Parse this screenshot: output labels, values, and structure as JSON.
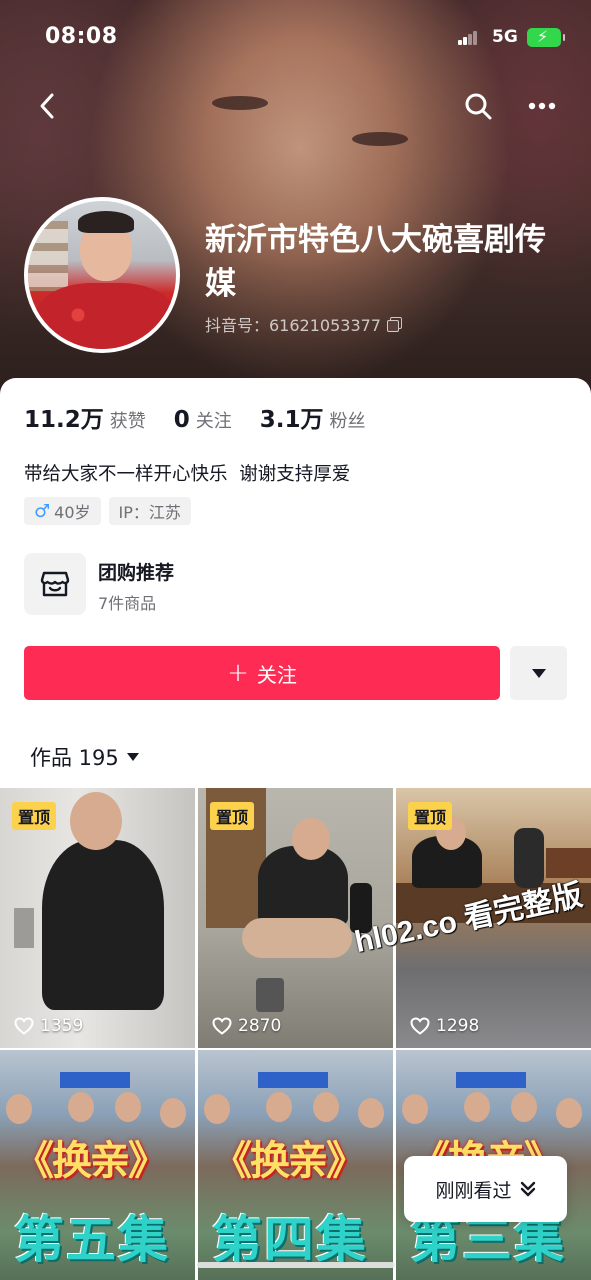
{
  "status_bar": {
    "time": "08:08",
    "network": "5G"
  },
  "profile": {
    "nickname": "新沂市特色八大碗喜剧传媒",
    "douyin_id": "抖音号：61621053377"
  },
  "stats": [
    {
      "value": "11.2万",
      "label": "获赞"
    },
    {
      "value": "0",
      "label": "关注"
    },
    {
      "value": "3.1万",
      "label": "粉丝"
    }
  ],
  "bio": "带给大家不一样开心快乐  谢谢支持厚爱",
  "tags": {
    "age": "40岁",
    "ip": "IP：江苏"
  },
  "shop": {
    "title": "团购推荐",
    "subtitle": "7件商品"
  },
  "follow_button": {
    "icon": "+",
    "label": "关注"
  },
  "works": {
    "label": "作品 195"
  },
  "videos": [
    {
      "pinned": "置顶",
      "likes": "1359"
    },
    {
      "pinned": "置顶",
      "likes": "2870"
    },
    {
      "pinned": "置顶",
      "likes": "1298"
    },
    {
      "title": "《换亲》",
      "episode": "第五集"
    },
    {
      "title": "《换亲》",
      "episode": "第四集"
    },
    {
      "title": "《换亲》",
      "episode": "第三集"
    }
  ],
  "watermark": "hl02.co 看完整版",
  "recent_pill": {
    "label": "刚刚看过"
  },
  "colors": {
    "accent": "#fe2c55",
    "pin_badge": "#fcd24c",
    "battery": "#32d74b"
  }
}
